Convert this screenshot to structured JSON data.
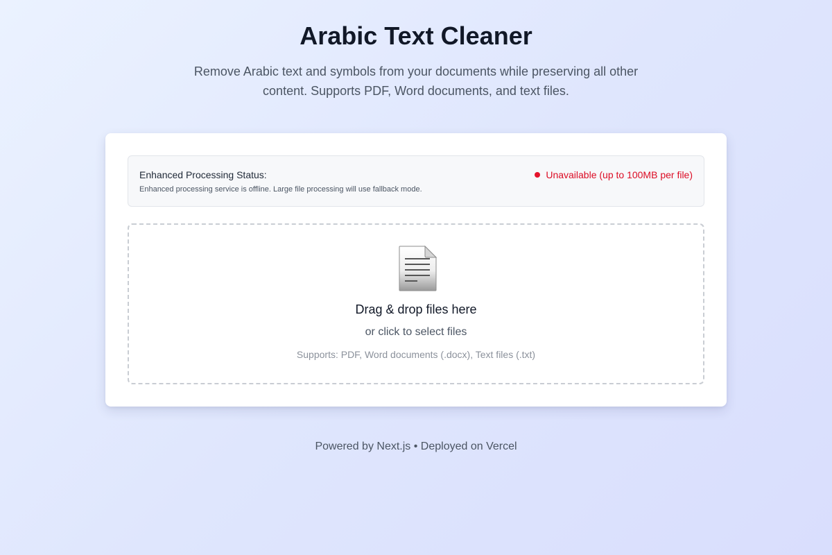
{
  "header": {
    "title": "Arabic Text Cleaner",
    "subtitle": "Remove Arabic text and symbols from your documents while preserving all other content. Supports PDF, Word documents, and text files."
  },
  "status": {
    "label": "Enhanced Processing Status:",
    "description": "Enhanced processing service is offline. Large file processing will use fallback mode.",
    "indicator_text": "Unavailable (up to 100MB per file)",
    "indicator_color": "#e5132b"
  },
  "dropzone": {
    "icon": "document-icon",
    "title": "Drag & drop files here",
    "subtitle": "or click to select files",
    "supports": "Supports: PDF, Word documents (.docx), Text files (.txt)"
  },
  "footer": {
    "text": "Powered by Next.js • Deployed on Vercel"
  }
}
